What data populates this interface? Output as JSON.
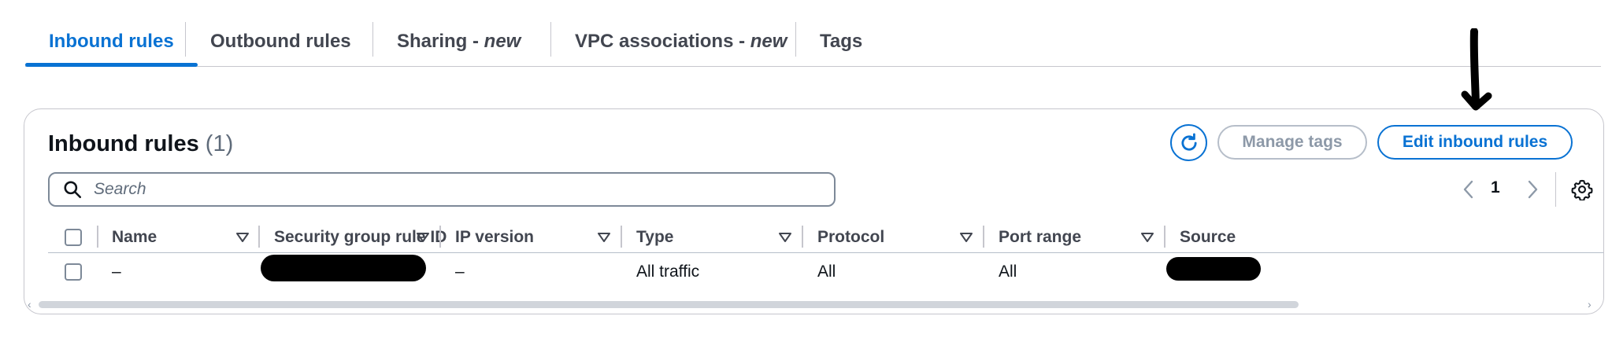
{
  "tabs": [
    {
      "label": "Inbound rules",
      "suffix": ""
    },
    {
      "label": "Outbound rules",
      "suffix": ""
    },
    {
      "label": "Sharing - ",
      "suffix": "new"
    },
    {
      "label": "VPC associations - ",
      "suffix": "new"
    },
    {
      "label": "Tags",
      "suffix": ""
    }
  ],
  "panel": {
    "title": "Inbound rules",
    "count": "(1)",
    "manage_tags": "Manage tags",
    "edit_inbound_rules": "Edit inbound rules"
  },
  "search": {
    "placeholder": "Search",
    "value": ""
  },
  "pagination": {
    "current_page": "1"
  },
  "table": {
    "columns": [
      "Name",
      "Security group rule ID",
      "IP version",
      "Type",
      "Protocol",
      "Port range",
      "Source"
    ],
    "rows": [
      {
        "name": "–",
        "rule_id": "",
        "ip_version": "–",
        "type": "All traffic",
        "protocol": "All",
        "port_range": "All",
        "source": ""
      }
    ]
  },
  "colors": {
    "accent": "#0972d3",
    "disabled": "#8d99a8",
    "border": "#c6c6cd",
    "text": "#0f141a"
  },
  "icons": [
    "refresh-icon",
    "search-icon",
    "chevron-left-icon",
    "chevron-right-icon",
    "settings-gear-icon",
    "sort-caret-icon",
    "annotation-arrow-icon"
  ]
}
